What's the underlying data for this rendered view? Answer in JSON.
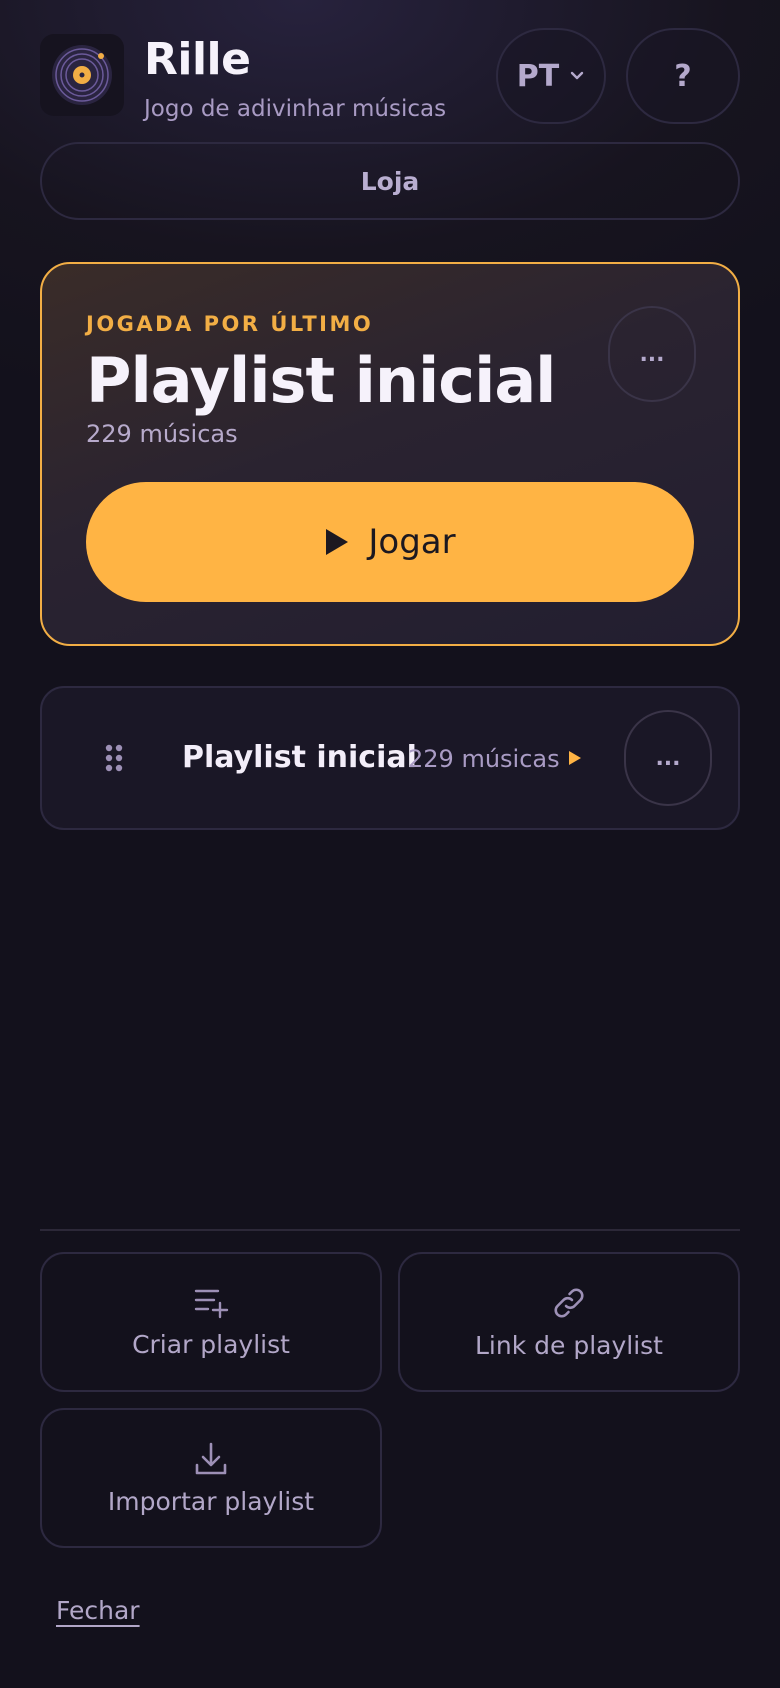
{
  "header": {
    "title": "Rille",
    "subtitle": "Jogo de adivinhar músicas",
    "language": "PT",
    "help_label": "?"
  },
  "shop": {
    "label": "Loja"
  },
  "last_played": {
    "label": "JOGADA POR ÚLTIMO",
    "title": "Playlist inicial",
    "count": "229 músicas",
    "more_label": "...",
    "play_label": "Jogar"
  },
  "playlists": [
    {
      "title": "Playlist inicial",
      "count": "229 músicas",
      "more_label": "..."
    }
  ],
  "actions": {
    "create_label": "Criar playlist",
    "link_label": "Link de playlist",
    "import_label": "Importar playlist"
  },
  "footer": {
    "close_label": "Fechar"
  },
  "colors": {
    "accent": "#ffb444",
    "background": "#13111c",
    "muted": "#a99bc4"
  },
  "icons": [
    "vinyl-logo-icon",
    "chevron-down-icon",
    "play-icon",
    "drag-handle-icon",
    "playlist-add-icon",
    "link-icon",
    "download-icon"
  ]
}
